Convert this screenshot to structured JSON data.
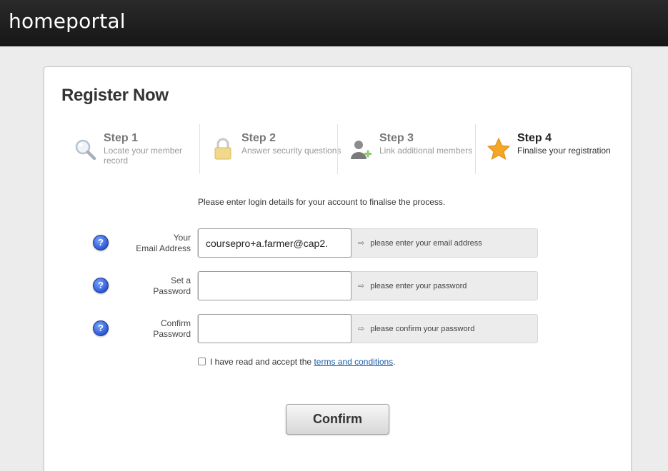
{
  "header": {
    "brand": "homeportal"
  },
  "page": {
    "title": "Register Now"
  },
  "steps": [
    {
      "title": "Step 1",
      "description": "Locate your member record",
      "icon": "magnifier-icon",
      "active": false
    },
    {
      "title": "Step 2",
      "description": "Answer security questions",
      "icon": "padlock-icon",
      "active": false
    },
    {
      "title": "Step 3",
      "description": "Link additional members",
      "icon": "add-member-icon",
      "active": false
    },
    {
      "title": "Step 4",
      "description": "Finalise your registration",
      "icon": "star-icon",
      "active": true
    }
  ],
  "form": {
    "intro": "Please enter login details for your account to finalise the process.",
    "help_glyph": "?",
    "hint_arrow": "⇨",
    "fields": [
      {
        "label_line1": "Your",
        "label_line2": "Email Address",
        "value": "coursepro+a.farmer@cap2.",
        "hint": "please enter your email address"
      },
      {
        "label_line1": "Set a",
        "label_line2": "Password",
        "value": "",
        "hint": "please enter your password"
      },
      {
        "label_line1": "Confirm",
        "label_line2": "Password",
        "value": "",
        "hint": "please confirm your password"
      }
    ],
    "terms_prefix": "I have read and accept the ",
    "terms_link": "terms and conditions",
    "terms_suffix": ".",
    "terms_checked": false,
    "confirm_label": "Confirm"
  },
  "colors": {
    "header_bg": "#1c1c1c",
    "help_icon": "#2c57d4",
    "link": "#1b5da6",
    "star": "#f5a623"
  }
}
